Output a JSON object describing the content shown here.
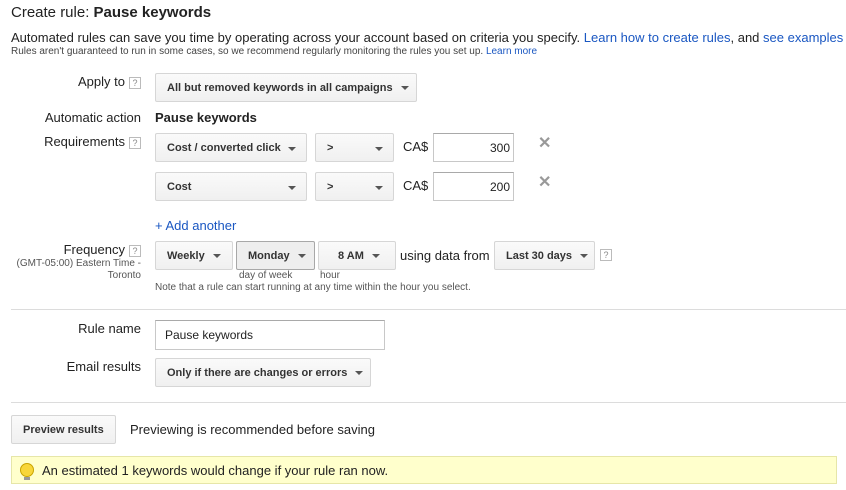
{
  "header": {
    "title_prefix": "Create rule: ",
    "title_name": "Pause keywords",
    "intro": "Automated rules can save you time by operating across your account based on criteria you specify.",
    "learn_create_link": "Learn how to create rules",
    "and_text": ", and",
    "examples_link": "see examples",
    "note": "Rules aren't guaranteed to run in some cases, so we recommend regularly monitoring the rules you set up.",
    "learn_more_link": "Learn more"
  },
  "apply_to": {
    "label": "Apply to",
    "value": "All but removed keywords in all campaigns"
  },
  "action": {
    "label": "Automatic action",
    "value": "Pause keywords"
  },
  "requirements": {
    "label": "Requirements",
    "rows": [
      {
        "metric": "Cost / converted click",
        "operator": ">",
        "currency": "CA$",
        "value": "300"
      },
      {
        "metric": "Cost",
        "operator": ">",
        "currency": "CA$",
        "value": "200"
      }
    ],
    "add_another": "+ Add another"
  },
  "frequency": {
    "label": "Frequency",
    "timezone_line1": "(GMT-05:00) Eastern Time -",
    "timezone_line2": "Toronto",
    "period": "Weekly",
    "day": "Monday",
    "hour": "8 AM",
    "using_data_from": "using data from",
    "range": "Last 30 days",
    "day_caption": "day of week",
    "hour_caption": "hour",
    "note": "Note that a rule can start running at any time within the hour you select."
  },
  "rule_name": {
    "label": "Rule name",
    "value": "Pause keywords"
  },
  "email": {
    "label": "Email results",
    "value": "Only if there are changes or errors"
  },
  "preview": {
    "button": "Preview results",
    "text": "Previewing is recommended before saving"
  },
  "banner": {
    "text": "An estimated 1 keywords would change if your rule ran now."
  },
  "help_glyph": "?",
  "remove_glyph": "✕",
  "colors": {
    "link": "#1a57c2",
    "banner_bg": "#ffffcc",
    "button_bg": "#f5f5f5"
  }
}
